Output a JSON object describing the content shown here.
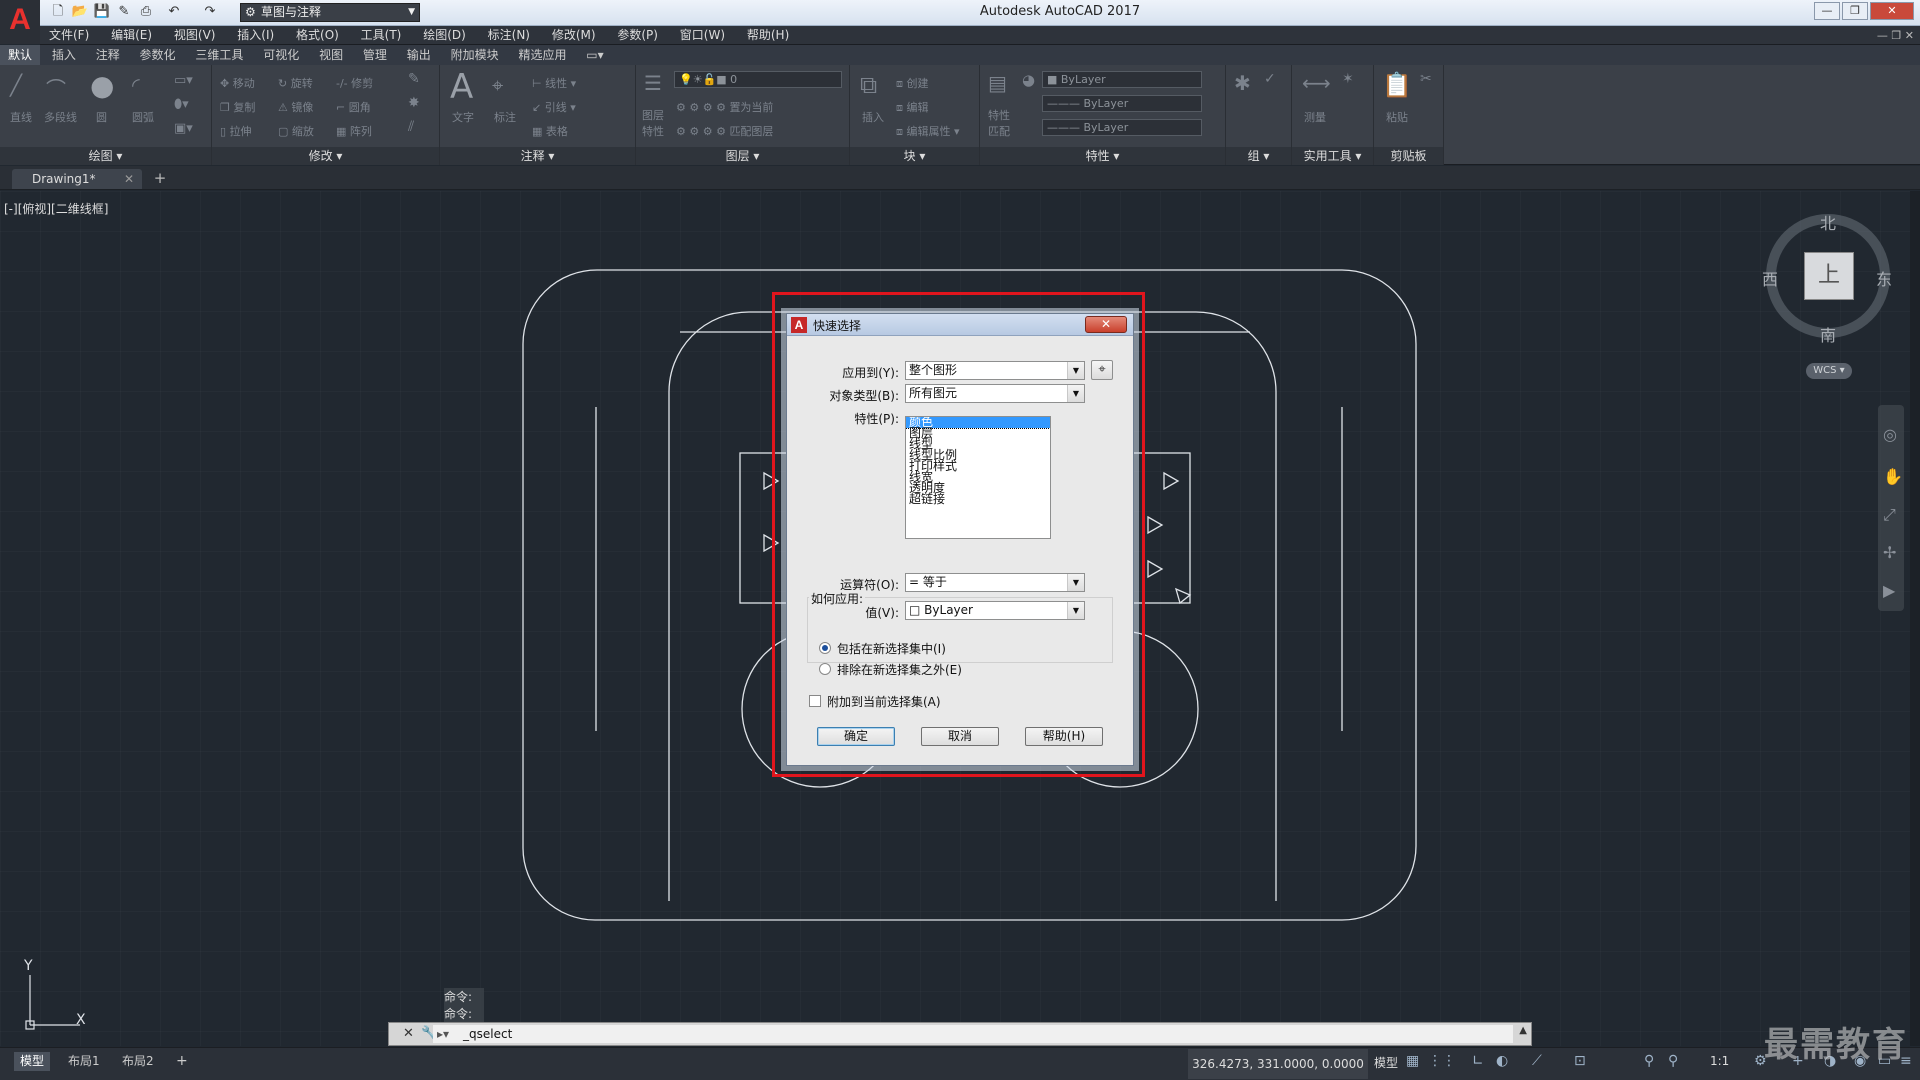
{
  "app": {
    "title": "Autodesk AutoCAD 2017",
    "logo": "A",
    "workspace": "草图与注释"
  },
  "menu": [
    "文件(F)",
    "编辑(E)",
    "视图(V)",
    "插入(I)",
    "格式(O)",
    "工具(T)",
    "绘图(D)",
    "标注(N)",
    "修改(M)",
    "参数(P)",
    "窗口(W)",
    "帮助(H)"
  ],
  "ribbon_tabs": [
    "默认",
    "插入",
    "注释",
    "参数化",
    "三维工具",
    "可视化",
    "视图",
    "管理",
    "输出",
    "附加模块",
    "精选应用"
  ],
  "ribbon": {
    "panels": [
      "绘图",
      "修改",
      "注释",
      "图层",
      "块",
      "特性",
      "组",
      "实用工具",
      "剪贴板"
    ],
    "draw_tools": [
      "直线",
      "多段线",
      "圆",
      "圆弧"
    ],
    "modify_tools": [
      "移动",
      "旋转",
      "修剪",
      "复制",
      "镜像",
      "圆角",
      "拉伸",
      "缩放",
      "阵列"
    ],
    "annot_tools": [
      "文字",
      "标注",
      "线性",
      "引线",
      "表格"
    ],
    "layer_value": "0",
    "layer_tools": [
      "图层特性",
      "置为当前",
      "匹配图层"
    ],
    "block_tools": [
      "插入",
      "创建",
      "编辑",
      "编辑属性"
    ],
    "properties": {
      "color": "ByLayer",
      "linetype": "ByLayer",
      "lineweight": "ByLayer",
      "match": "特性匹配"
    },
    "util_tools": [
      "测量"
    ],
    "clip_tools": [
      "粘贴"
    ]
  },
  "document": {
    "tab": "Drawing1*",
    "view_label": "[-][俯视][二维线框]"
  },
  "viewcube": {
    "north": "北",
    "south": "南",
    "east": "东",
    "west": "西",
    "top": "上",
    "wcs": "WCS"
  },
  "ucs": {
    "x": "X",
    "y": "Y"
  },
  "dialog": {
    "title": "快速选择",
    "close": "✕",
    "apply_to_label": "应用到(Y):",
    "apply_to_value": "整个图形",
    "object_type_label": "对象类型(B):",
    "object_type_value": "所有图元",
    "properties_label": "特性(P):",
    "properties": [
      "颜色",
      "图层",
      "线型",
      "线型比例",
      "打印样式",
      "线宽",
      "透明度",
      "超链接"
    ],
    "operator_label": "运算符(O):",
    "operator_value": "= 等于",
    "value_label": "值(V):",
    "value_value": "ByLayer",
    "how_label": "如何应用:",
    "include_label": "包括在新选择集中(I)",
    "exclude_label": "排除在新选择集之外(E)",
    "append_label": "附加到当前选择集(A)",
    "ok": "确定",
    "cancel": "取消",
    "help": "帮助(H)"
  },
  "command": {
    "history": [
      "命令:",
      "命令:"
    ],
    "input": "_qselect"
  },
  "status": {
    "layouts": [
      "模型",
      "布局1",
      "布局2"
    ],
    "coords": "326.4273, 331.0000, 0.0000",
    "model": "模型",
    "scale": "1:1"
  },
  "watermark": "最需教育",
  "colors": {
    "highlight": "#e0151d",
    "canvas": "#212830"
  }
}
